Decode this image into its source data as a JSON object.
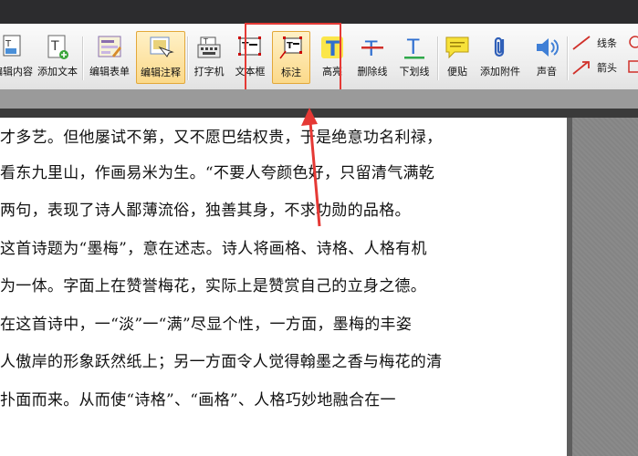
{
  "toolbar": {
    "buttons": [
      {
        "label": "编辑内容",
        "icon": "edit-content-icon"
      },
      {
        "label": "添加文本",
        "icon": "add-text-icon"
      },
      {
        "label": "编辑表单",
        "icon": "edit-form-icon"
      },
      {
        "label": "编辑注释",
        "icon": "edit-annotation-icon"
      },
      {
        "label": "打字机",
        "icon": "typewriter-icon"
      },
      {
        "label": "文本框",
        "icon": "textbox-icon"
      },
      {
        "label": "标注",
        "icon": "callout-icon"
      },
      {
        "label": "高亮",
        "icon": "highlight-icon"
      },
      {
        "label": "删除线",
        "icon": "strikethrough-icon"
      },
      {
        "label": "下划线",
        "icon": "underline-icon"
      },
      {
        "label": "便贴",
        "icon": "sticky-note-icon"
      },
      {
        "label": "添加附件",
        "icon": "paperclip-icon"
      },
      {
        "label": "声音",
        "icon": "speaker-icon"
      },
      {
        "label": "线条",
        "icon": "line-icon"
      },
      {
        "label": "箭头",
        "icon": "arrow-icon"
      }
    ]
  },
  "document": {
    "lines": [
      "才多艺。但他屡试不第，又不愿巴结权贵，于是绝意功名利禄，",
      "看东九里山，作画易米为生。“不要人夸颜色好，只留清气满乾",
      "两句，表现了诗人鄙薄流俗，独善其身，不求功勋的品格。",
      "这首诗题为“墨梅”，意在述志。诗人将画格、诗格、人格有机",
      "为一体。字面上在赞誉梅花，实际上是赞赏自己的立身之德。",
      "在这首诗中，一“淡”一“满”尽显个性，一方面，墨梅的丰姿",
      "人傲岸的形象跃然纸上；另一方面令人觉得翰墨之香与梅花的清",
      "扑面而来。从而使“诗格”、“画格”、人格巧妙地融合在一"
    ]
  },
  "colors": {
    "annotation_red": "#e53935",
    "active_button": "#fbd98a"
  }
}
